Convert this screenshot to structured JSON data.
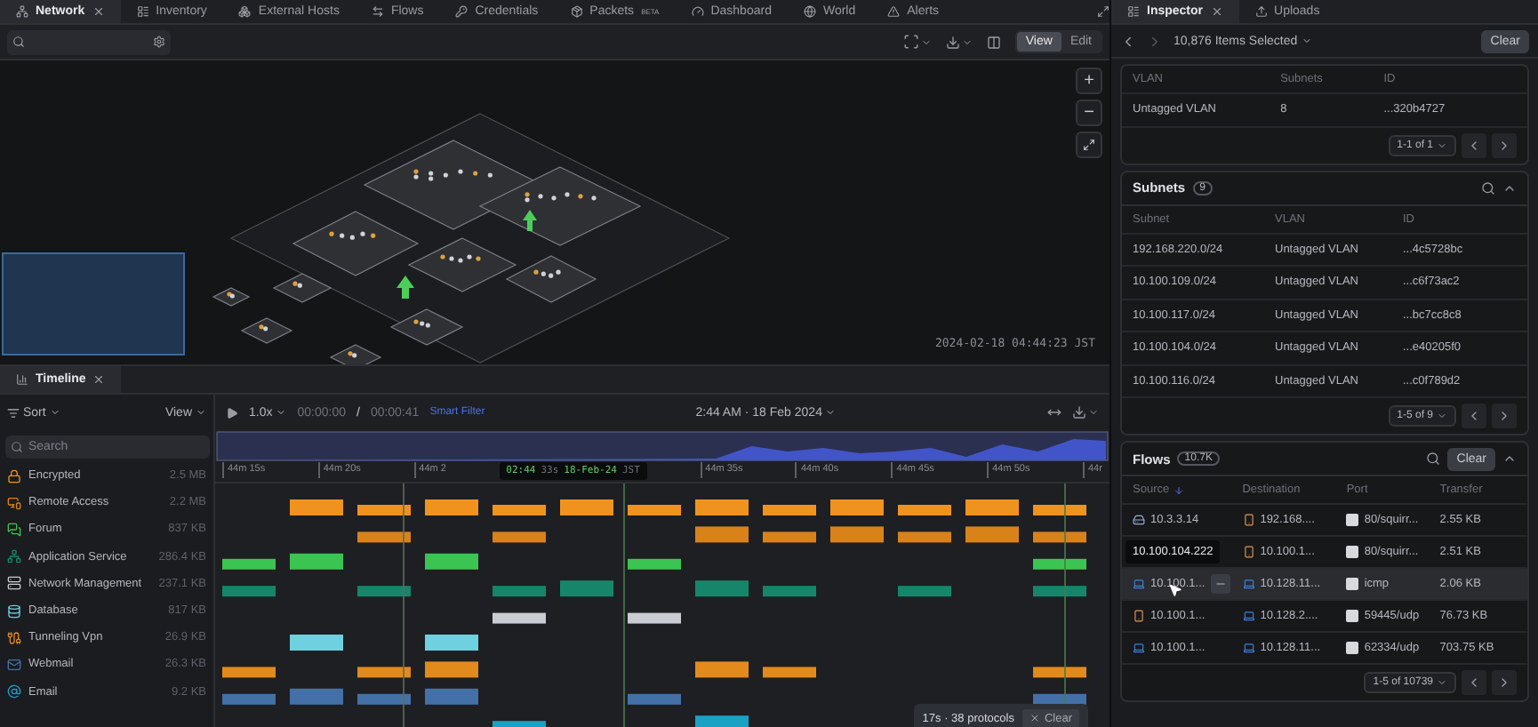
{
  "top_tabs": [
    {
      "label": "Network",
      "selected": true,
      "closable": true
    },
    {
      "label": "Inventory",
      "selected": false,
      "kind": "inventory"
    },
    {
      "label": "External Hosts",
      "selected": false,
      "kind": "hosts"
    },
    {
      "label": "Flows",
      "selected": false,
      "kind": "flows"
    },
    {
      "label": "Credentials",
      "selected": false,
      "kind": "credentials"
    },
    {
      "label": "Packets",
      "badge": "BETA",
      "selected": false,
      "kind": "packets"
    },
    {
      "label": "Dashboard",
      "selected": false,
      "kind": "dashboard"
    },
    {
      "label": "World",
      "selected": false,
      "kind": "world"
    },
    {
      "label": "Alerts",
      "selected": false,
      "kind": "alerts"
    }
  ],
  "toolbar": {
    "mode_buttons": [
      {
        "label": "View",
        "selected": true
      },
      {
        "label": "Edit",
        "selected": false
      }
    ]
  },
  "canvas": {
    "zoom_in": "+",
    "zoom_out": "−",
    "timestamp": "2024-02-18 04:44:23 JST"
  },
  "timeline": {
    "tab": "Timeline",
    "sort": "Sort",
    "view": "View",
    "search_placeholder": "Search",
    "speed": "1.0x",
    "elapsed": "00:00:00",
    "separator": "/",
    "duration": "00:00:41",
    "smart_filter": "Smart Filter",
    "datetime": "2:44 AM · 18 Feb 2024",
    "ticks": [
      "44m 15s",
      "44m 20s",
      "44m 2",
      "44m 35s",
      "44m 40s",
      "44m 45s",
      "44m 50s",
      "44r"
    ],
    "cursor_tooltip": {
      "time": "02:44",
      "seconds": "33s",
      "date": "18-Feb-24",
      "zone": "JST"
    },
    "categories": [
      {
        "name": "Encrypted",
        "size": "2.5 MB",
        "kind": "lock",
        "color": "#f0931e"
      },
      {
        "name": "Remote Access",
        "size": "2.2 MB",
        "kind": "remote",
        "color": "#d9821a"
      },
      {
        "name": "Forum",
        "size": "837 KB",
        "kind": "forum",
        "color": "#3cc452"
      },
      {
        "name": "Application Service",
        "size": "286.4 KB",
        "kind": "service",
        "color": "#16866a"
      },
      {
        "name": "Network Management",
        "size": "237.1 KB",
        "kind": "management",
        "color": "#c9ccd2"
      },
      {
        "name": "Database",
        "size": "817 KB",
        "kind": "database",
        "color": "#6fd0e0"
      },
      {
        "name": "Tunneling Vpn",
        "size": "26.9 KB",
        "kind": "vpn",
        "color": "#e38a1c"
      },
      {
        "name": "Webmail",
        "size": "26.3 KB",
        "kind": "webmail",
        "color": "#4470a8"
      },
      {
        "name": "Email",
        "size": "9.2 KB",
        "kind": "email",
        "color": "#1aa2c4"
      }
    ],
    "selection_bar": {
      "summary": "17s · 38 protocols",
      "clear": "Clear"
    }
  },
  "inspector": {
    "tabs": [
      {
        "label": "Inspector",
        "selected": true
      },
      {
        "label": "Uploads",
        "selected": false
      }
    ],
    "selection": "10,876 Items Selected",
    "clear": "Clear",
    "vlans": {
      "columns": [
        "VLAN",
        "Subnets",
        "ID"
      ],
      "rows": [
        [
          "Untagged VLAN",
          "8",
          "...320b4727"
        ]
      ],
      "pagination": "1-1 of 1"
    },
    "subnets": {
      "title": "Subnets",
      "count": "9",
      "columns": [
        "Subnet",
        "VLAN",
        "ID"
      ],
      "rows": [
        [
          "192.168.220.0/24",
          "Untagged VLAN",
          "...4c5728bc"
        ],
        [
          "10.100.109.0/24",
          "Untagged VLAN",
          "...c6f73ac2"
        ],
        [
          "10.100.117.0/24",
          "Untagged VLAN",
          "...bc7cc8c8"
        ],
        [
          "10.100.104.0/24",
          "Untagged VLAN",
          "...e40205f0"
        ],
        [
          "10.100.116.0/24",
          "Untagged VLAN",
          "...c0f789d2"
        ]
      ],
      "pagination": "1-5 of 9"
    },
    "flows": {
      "title": "Flows",
      "count": "10.7K",
      "clear": "Clear",
      "columns": [
        "Source",
        "Destination",
        "Port",
        "Transfer"
      ],
      "rows": [
        {
          "source": {
            "address": "10.3.3.14",
            "kind": "server"
          },
          "destination": {
            "address": "192.168....",
            "kind": "device"
          },
          "port": "80/squirr...",
          "transfer": "2.55 KB",
          "hovered": false
        },
        {
          "source": {
            "kind": "device"
          },
          "destination": {
            "address": "10.100.1...",
            "kind": "device"
          },
          "port": "80/squirr...",
          "transfer": "2.51 KB",
          "hovered": false
        },
        {
          "source": {
            "address": "10.100.1...",
            "kind": "workstation"
          },
          "destination": {
            "address": "10.128.11...",
            "kind": "workstation"
          },
          "port": "icmp",
          "transfer": "2.06 KB",
          "hovered": true,
          "tooltip": "10.100.104.222"
        },
        {
          "source": {
            "address": "10.100.1...",
            "kind": "device"
          },
          "destination": {
            "address": "10.128.2....",
            "kind": "workstation"
          },
          "port": "59445/udp",
          "transfer": "76.73 KB",
          "hovered": false
        },
        {
          "source": {
            "address": "10.100.1...",
            "kind": "workstation"
          },
          "destination": {
            "address": "10.128.11...",
            "kind": "workstation"
          },
          "port": "62334/udp",
          "transfer": "703.75 KB",
          "hovered": false
        }
      ],
      "pagination": "1-5 of 10739"
    }
  }
}
